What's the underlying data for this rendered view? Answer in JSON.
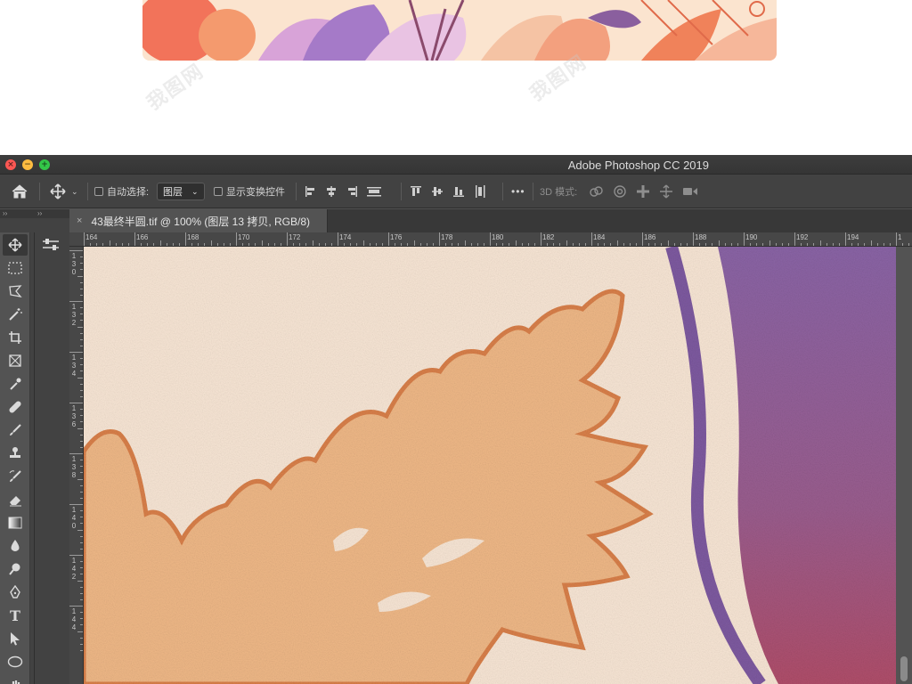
{
  "window": {
    "title": "Adobe Photoshop CC 2019"
  },
  "options_bar": {
    "auto_select_label": "自动选择:",
    "auto_select_target": "图层",
    "show_transform_label": "显示变换控件",
    "mode_3d_label": "3D 模式:",
    "more_label": "•••"
  },
  "document_tab": {
    "title": "43最终半圆.tif @ 100% (图层 13 拷贝, RGB/8)",
    "close_glyph": "×"
  },
  "panel_collapse_left": "››",
  "panel_collapse_right": "››",
  "rulers": {
    "horizontal": [
      "164",
      "166",
      "168",
      "170",
      "172",
      "174",
      "176",
      "178",
      "180",
      "182",
      "184",
      "186",
      "188",
      "190",
      "192",
      "194",
      "1"
    ],
    "vertical": [
      "130",
      "132",
      "134",
      "136",
      "138",
      "140",
      "142",
      "144"
    ]
  },
  "watermark_text": "我图网",
  "colors": {
    "leaf_orange": "#efb887",
    "leaf_edge": "#d9804a",
    "purple": "#8a5f9e",
    "canvas_bg": "#f7e6d6"
  }
}
